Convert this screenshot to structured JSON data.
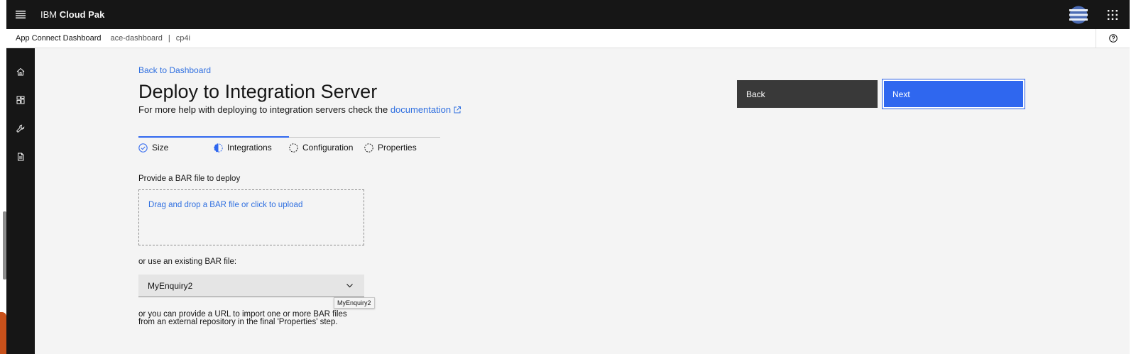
{
  "header": {
    "brand_prefix": "IBM",
    "brand_name": "Cloud Pak"
  },
  "subheader": {
    "app_name": "App Connect Dashboard",
    "instance": "ace-dashboard",
    "separator": "|",
    "namespace": "cp4i"
  },
  "sidenav": {
    "items": [
      {
        "icon": "home-icon"
      },
      {
        "icon": "dashboard-icon"
      },
      {
        "icon": "wrench-icon"
      },
      {
        "icon": "document-icon"
      }
    ]
  },
  "page": {
    "back_link": "Back to Dashboard",
    "title": "Deploy to Integration Server",
    "help_text": "For more help with deploying to integration servers check the",
    "doc_link": "documentation"
  },
  "actions": {
    "back_label": "Back",
    "next_label": "Next"
  },
  "progress": {
    "steps": [
      {
        "label": "Size",
        "state": "complete"
      },
      {
        "label": "Integrations",
        "state": "current"
      },
      {
        "label": "Configuration",
        "state": "incomplete"
      },
      {
        "label": "Properties",
        "state": "incomplete"
      }
    ]
  },
  "form": {
    "bar_label": "Provide a BAR file to deploy",
    "dropzone_text": "Drag and drop a BAR file or click to upload",
    "existing_label": "or use an existing BAR file:",
    "existing_value": "MyEnquiry2",
    "tooltip": "MyEnquiry2",
    "url_note_line1": "or you can provide a URL to import one or more BAR files",
    "url_note_line2": "from an external repository in the final 'Properties' step."
  },
  "colors": {
    "primary": "#2f67ef",
    "link": "#2f6fe0",
    "header_bg": "#161616",
    "secondary_button": "#393939",
    "page_bg": "#f4f4f4"
  }
}
